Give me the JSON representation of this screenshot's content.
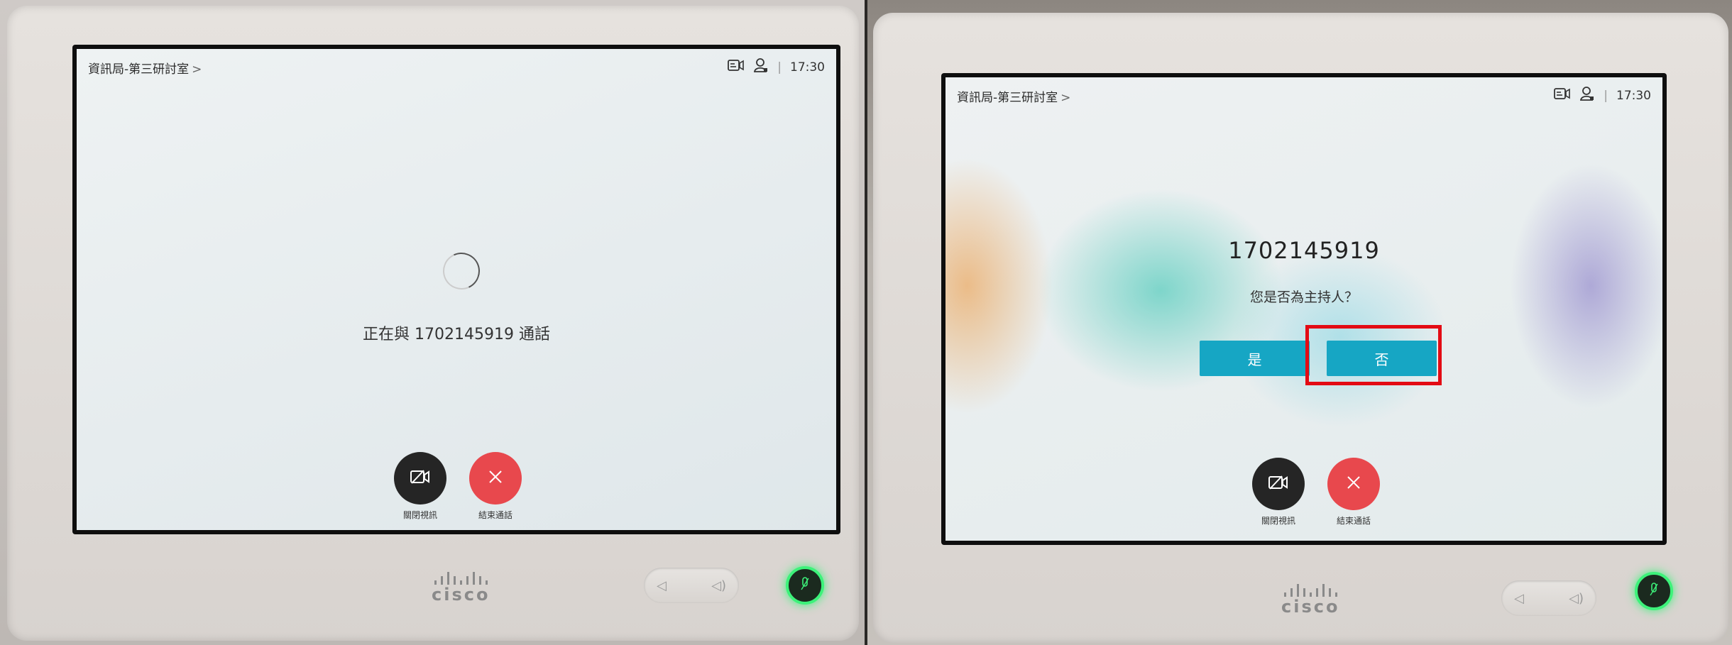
{
  "left_panel": {
    "room_name": "資訊局-第三研討室",
    "room_chevron": ">",
    "status": {
      "time": "17:30",
      "separator": "|"
    },
    "call_status_prefix": "正在與",
    "call_number": "1702145919",
    "call_status_suffix": "通話",
    "controls": {
      "camera_off_label": "關閉視訊",
      "end_call_label": "結束通話"
    },
    "brand": "cisco"
  },
  "right_panel": {
    "room_name": "資訊局-第三研討室",
    "room_chevron": ">",
    "status": {
      "time": "17:30",
      "separator": "|"
    },
    "dialed_number": "1702145919",
    "host_question": "您是否為主持人？",
    "yes_label": "是",
    "no_label": "否",
    "controls": {
      "camera_off_label": "關閉視訊",
      "end_call_label": "結束通話"
    },
    "brand": "cisco"
  },
  "colors": {
    "end_call": "#e8484d",
    "choice_button": "#16a6c4",
    "highlight": "#e30b14",
    "mute_led": "#3df27a"
  },
  "icons": [
    "camera-menu-icon",
    "user-icon",
    "camera-off-icon",
    "close-icon",
    "microphone-icon",
    "volume-down-icon",
    "volume-up-icon"
  ]
}
